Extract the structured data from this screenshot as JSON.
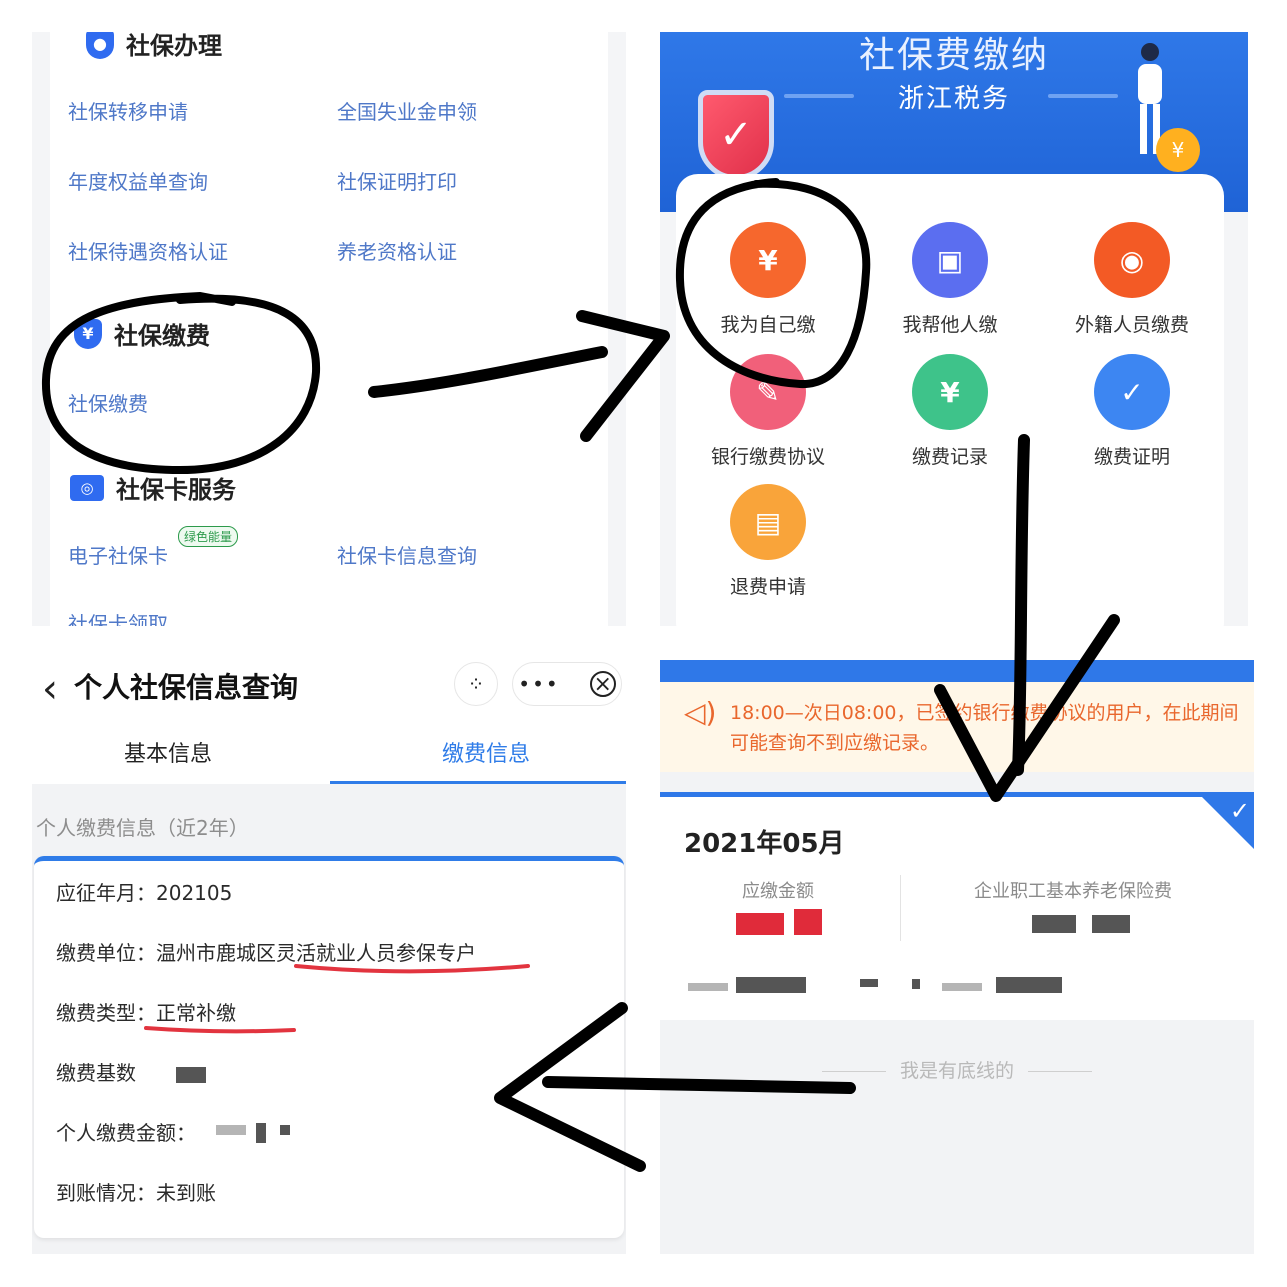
{
  "panel1": {
    "sections": [
      {
        "title": "社保办理"
      },
      {
        "title": "社保缴费"
      },
      {
        "title": "社保卡服务"
      }
    ],
    "links": [
      "社保转移申请",
      "全国失业金申领",
      "年度权益单查询",
      "社保证明打印",
      "社保待遇资格认证",
      "养老资格认证",
      "社保缴费",
      "电子社保卡",
      "社保卡信息查询",
      "社保卡领取"
    ],
    "shield_glyph": "¥",
    "green_badge": "绿色能量"
  },
  "panel2": {
    "banner_title": "社保费缴纳",
    "banner_subtitle": "浙江税务",
    "coin_glyph": "¥",
    "items": [
      {
        "label": "我为自己缴",
        "icon": "hand-coin-icon",
        "color": "#f6672d",
        "glyph": "¥"
      },
      {
        "label": "我帮他人缴",
        "icon": "wallet-icon",
        "color": "#5b6ef0",
        "glyph": "▣"
      },
      {
        "label": "外籍人员缴费",
        "icon": "passport-icon",
        "color": "#f35a25",
        "glyph": "◉"
      },
      {
        "label": "银行缴费协议",
        "icon": "contract-icon",
        "color": "#f1607a",
        "glyph": "✎"
      },
      {
        "label": "缴费记录",
        "icon": "record-icon",
        "color": "#3ec38a",
        "glyph": "¥"
      },
      {
        "label": "缴费证明",
        "icon": "certificate-icon",
        "color": "#3d86f2",
        "glyph": "✓"
      },
      {
        "label": "退费申请",
        "icon": "refund-card-icon",
        "color": "#f9a43a",
        "glyph": "▤"
      }
    ]
  },
  "panel3": {
    "back_glyph": "‹",
    "title": "个人社保信息查询",
    "tabs": [
      {
        "label": "基本信息",
        "active": false
      },
      {
        "label": "缴费信息",
        "active": true
      }
    ],
    "section_caption": "个人缴费信息（近2年）",
    "rows": [
      {
        "label": "应征年月：",
        "value": "202105"
      },
      {
        "label": "缴费单位：",
        "value": "温州市鹿城区灵活就业人员参保专户"
      },
      {
        "label": "缴费类型：",
        "value": "正常补缴"
      },
      {
        "label": "缴费基数",
        "value": ""
      },
      {
        "label": "个人缴费金额：",
        "value": ""
      },
      {
        "label": "到账情况：",
        "value": "未到账"
      }
    ],
    "accent_color": "#2f7ce8"
  },
  "panel4": {
    "notice": "18:00—次日08:00，已签约银行缴费协议的用户，在此期间可能查询不到应缴记录。",
    "month": "2021年05月",
    "col1_label": "应缴金额",
    "col2_label": "企业职工基本养老保险费",
    "footer": "我是有底线的",
    "accent_color": "#2f78e8",
    "notice_color": "#e9672d"
  }
}
